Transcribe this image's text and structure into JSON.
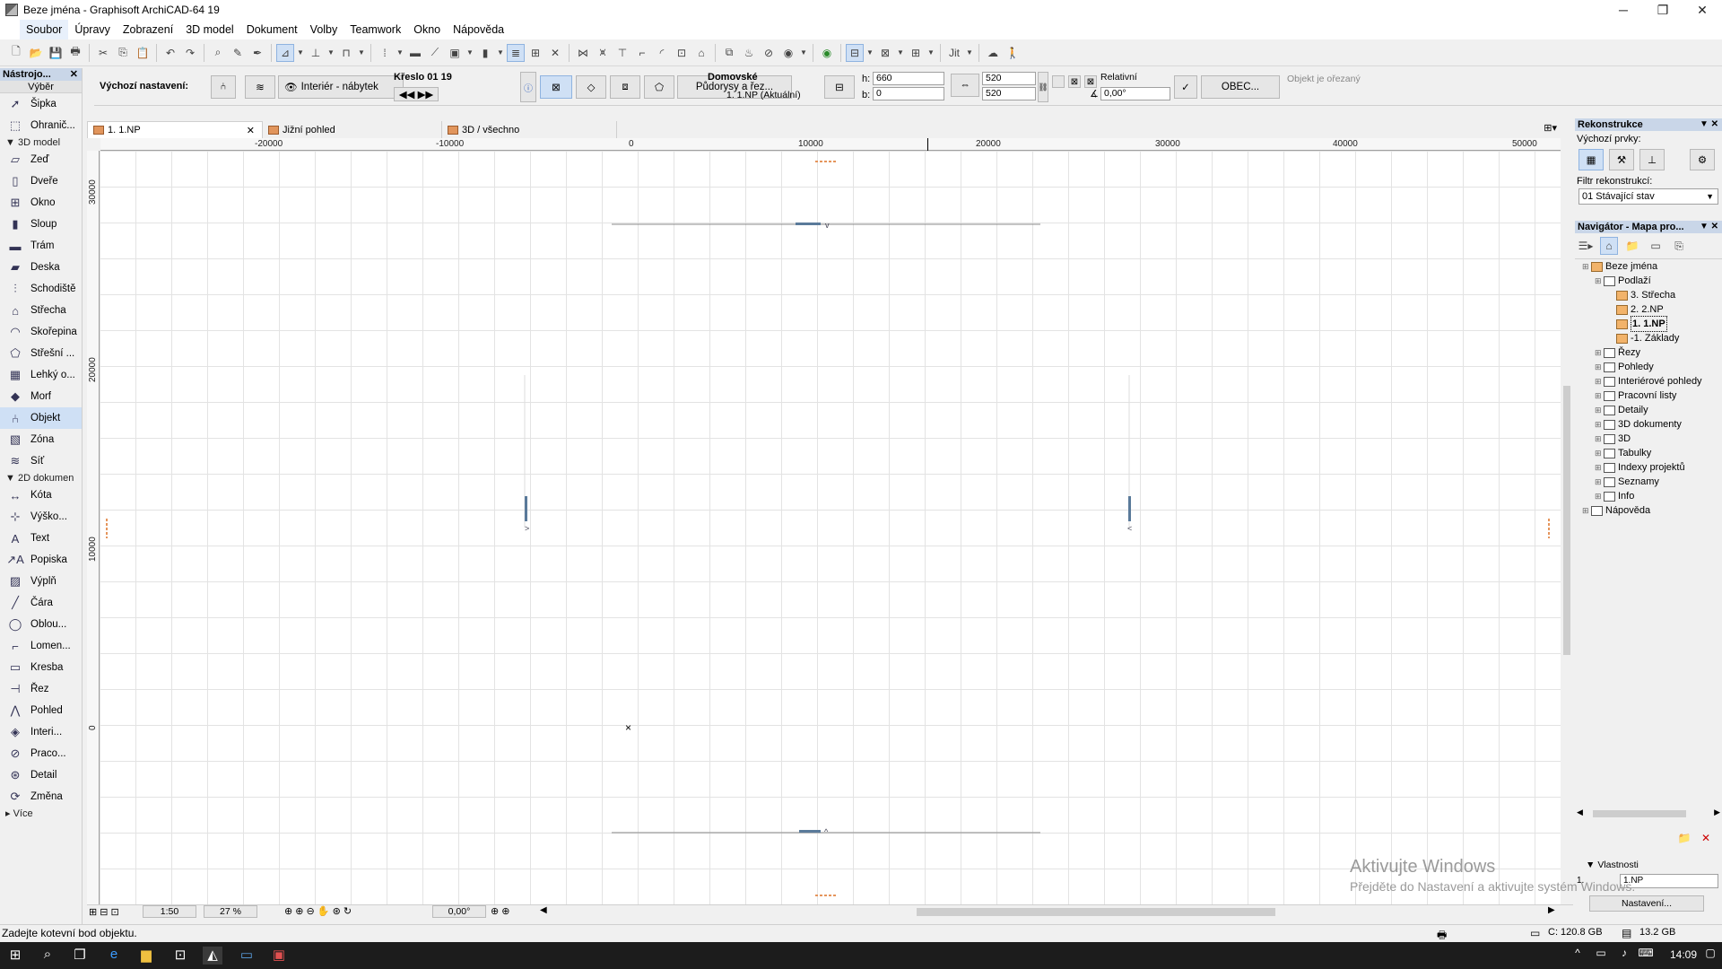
{
  "window": {
    "title": "Beze jména - Graphisoft ArchiCAD-64 19",
    "minimize": "─",
    "maximize": "❐",
    "close": "✕"
  },
  "menu": [
    "Soubor",
    "Úpravy",
    "Zobrazení",
    "3D model",
    "Dokument",
    "Volby",
    "Teamwork",
    "Okno",
    "Nápověda"
  ],
  "infobox": {
    "default_settings": "Výchozí nastavení:",
    "layer": "Interiér - nábytek",
    "object_name": "Křeslo 01 19",
    "floorplans_button": "Půdorysy a řez...",
    "home_label": "Domovské",
    "home_story": "1. 1.NP (Aktuální)",
    "h_label": "h:",
    "h_value": "660",
    "b_label": "b:",
    "b_value": "0",
    "size_a": "520",
    "size_b": "520",
    "relative_label": "Relativní",
    "angle": "0,00°",
    "general_button": "OBEC...",
    "object_cut": "Objekt je ořezaný"
  },
  "toolbox": {
    "title": "Nástrojo...",
    "selection": "Výběr",
    "items_top": [
      {
        "label": "Šipka",
        "icon": "arrow-icon"
      },
      {
        "label": "Ohranič...",
        "icon": "marquee-icon"
      }
    ],
    "group_3d": "3D model",
    "items_3d": [
      {
        "label": "Zeď",
        "icon": "wall-icon"
      },
      {
        "label": "Dveře",
        "icon": "door-icon"
      },
      {
        "label": "Okno",
        "icon": "window-icon"
      },
      {
        "label": "Sloup",
        "icon": "column-icon"
      },
      {
        "label": "Trám",
        "icon": "beam-icon"
      },
      {
        "label": "Deska",
        "icon": "slab-icon"
      },
      {
        "label": "Schodiště",
        "icon": "stair-icon"
      },
      {
        "label": "Střecha",
        "icon": "roof-icon"
      },
      {
        "label": "Skořepina",
        "icon": "shell-icon"
      },
      {
        "label": "Střešní ...",
        "icon": "skylight-icon"
      },
      {
        "label": "Lehký o...",
        "icon": "curtain-wall-icon"
      },
      {
        "label": "Morf",
        "icon": "morph-icon"
      },
      {
        "label": "Objekt",
        "icon": "object-icon",
        "selected": true
      },
      {
        "label": "Zóna",
        "icon": "zone-icon"
      },
      {
        "label": "Síť",
        "icon": "mesh-icon"
      }
    ],
    "group_2d": "2D dokumen",
    "items_2d": [
      {
        "label": "Kóta",
        "icon": "dimension-icon"
      },
      {
        "label": "Výško...",
        "icon": "level-dimension-icon"
      },
      {
        "label": "Text",
        "icon": "text-icon"
      },
      {
        "label": "Popiska",
        "icon": "label-icon"
      },
      {
        "label": "Výplň",
        "icon": "fill-icon"
      },
      {
        "label": "Čára",
        "icon": "line-icon"
      },
      {
        "label": "Oblou...",
        "icon": "arc-icon"
      },
      {
        "label": "Lomen...",
        "icon": "polyline-icon"
      },
      {
        "label": "Kresba",
        "icon": "drawing-icon"
      },
      {
        "label": "Řez",
        "icon": "section-icon"
      },
      {
        "label": "Pohled",
        "icon": "elevation-icon"
      },
      {
        "label": "Interi...",
        "icon": "interior-elevation-icon"
      },
      {
        "label": "Praco...",
        "icon": "worksheet-icon"
      },
      {
        "label": "Detail",
        "icon": "detail-icon"
      },
      {
        "label": "Změna",
        "icon": "change-icon"
      }
    ],
    "more": "Více"
  },
  "tabs": [
    {
      "label": "1. 1.NP",
      "active": true
    },
    {
      "label": "Jižní pohled"
    },
    {
      "label": "3D / všechno"
    }
  ],
  "ruler_h": [
    "-20000",
    "-10000",
    "0",
    "10000",
    "20000",
    "30000",
    "40000",
    "50000"
  ],
  "ruler_v": [
    "30000",
    "20000",
    "10000",
    "0"
  ],
  "view_status": {
    "scale": "1:50",
    "zoom": "27 %",
    "angle": "0,00°"
  },
  "status": {
    "prompt": "Zadejte kotevní bod objektu.",
    "disk": "C: 120.8 GB",
    "memory": "13.2 GB"
  },
  "reconstruction": {
    "title": "Rekonstrukce",
    "default_elements": "Výchozí prvky:",
    "filter_label": "Filtr rekonstrukcí:",
    "filter_value": "01 Stávající stav"
  },
  "navigator": {
    "title": "Navigátor - Mapa pro...",
    "tree": [
      {
        "label": "Beze jména",
        "level": 0,
        "folder": true
      },
      {
        "label": "Podlaží",
        "level": 1
      },
      {
        "label": "3. Střecha",
        "level": 2,
        "folder": true
      },
      {
        "label": "2. 2.NP",
        "level": 2,
        "folder": true
      },
      {
        "label": "1. 1.NP",
        "level": 2,
        "folder": true,
        "bold": true
      },
      {
        "label": "-1. Základy",
        "level": 2,
        "folder": true
      },
      {
        "label": "Řezy",
        "level": 1
      },
      {
        "label": "Pohledy",
        "level": 1
      },
      {
        "label": "Interiérové pohledy",
        "level": 1
      },
      {
        "label": "Pracovní listy",
        "level": 1
      },
      {
        "label": "Detaily",
        "level": 1
      },
      {
        "label": "3D dokumenty",
        "level": 1
      },
      {
        "label": "3D",
        "level": 1
      },
      {
        "label": "Tabulky",
        "level": 1
      },
      {
        "label": "Indexy projektů",
        "level": 1
      },
      {
        "label": "Seznamy",
        "level": 1
      },
      {
        "label": "Info",
        "level": 1
      },
      {
        "label": "Nápověda",
        "level": 0
      }
    ],
    "properties": "Vlastnosti",
    "prop_index": "1.",
    "prop_value": "1.NP",
    "settings_button": "Nastavení..."
  },
  "watermark": {
    "line1": "Aktivujte Windows",
    "line2": "Přejděte do Nastavení a aktivujte systém Windows."
  },
  "taskbar": {
    "time": "14:09"
  },
  "colors": {
    "accent": "#c9d6e8",
    "selected": "#cfe0f5",
    "taskbar": "#1c1c1c"
  }
}
